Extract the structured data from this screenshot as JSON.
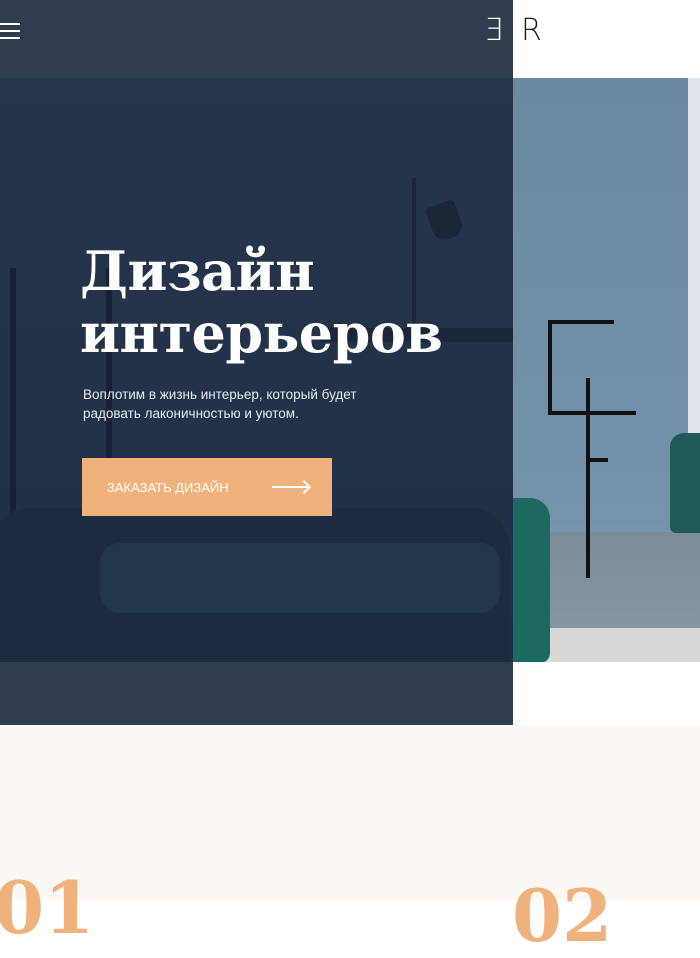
{
  "header": {
    "menu_icon": "hamburger-menu-icon",
    "logo_left": "Ǝ",
    "logo_right": "R"
  },
  "hero": {
    "title_line1": "Дизайн",
    "title_line2": "интерьеров",
    "subtitle": "Воплотим в жизнь интерьер, который будет радовать лаконичностью и уютом.",
    "cta_label": "ЗАКАЗАТЬ ДИЗАЙН",
    "cta_icon": "arrow-right-icon"
  },
  "steps": {
    "first_number": "01",
    "second_number": "02"
  },
  "colors": {
    "panel": "#2f3d4f",
    "accent": "#f0b27c",
    "section_bg": "#fbf8f3"
  }
}
